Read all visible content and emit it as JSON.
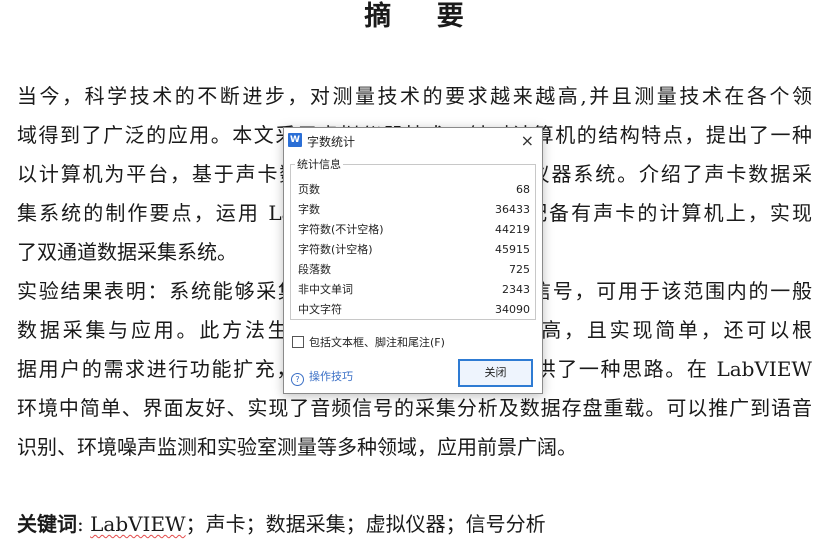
{
  "document": {
    "title": "摘  要",
    "lines": [
      "    当今，科学技术的不断进步，对测量技术的要求越来越高,并且测量技术在各个领",
      "域得到了广泛的应用。本文采用虚拟仪器技术，针对计算机的结构特点，提出了一种",
      "以计算机为平台，基于声卡数据采集的LabVIEW虚拟仪器系统。介绍了声卡数据采",
      "集系统的制作要点，运用 LabVIEW 图形化编程，在配备有声卡的计算机上，实现",
      "了双通道数据采集系统。",
      "    实验结果表明：系统能够采集频率为20Hz～20kHz的信号，可用于该范围内的一般",
      "数据采集与应用。此方法生成的虚拟仪器系统性价比高，且实现简单，还可以根",
      "据用户的需求进行功能扩充，为声卡数据采集的应用提供了一种思路。在 LabVIEW",
      "环境中简单、界面友好、实现了音频信号的采集分析及数据存盘重载。可以推广到语音",
      "识别、环境噪声监测和实验室测量等多种领域，应用前景广阔。"
    ],
    "keywords_label": "关键词",
    "keywords_brand": "LabVIEW",
    "keywords_rest": "；声卡；数据采集；虚拟仪器；信号分析"
  },
  "dialog": {
    "title": "字数统计",
    "app_icon": "W",
    "close_icon": "×",
    "group_label": "统计信息",
    "stats": [
      {
        "label": "页数",
        "value": "68"
      },
      {
        "label": "字数",
        "value": "36433"
      },
      {
        "label": "字符数(不计空格)",
        "value": "44219"
      },
      {
        "label": "字符数(计空格)",
        "value": "45915"
      },
      {
        "label": "段落数",
        "value": "725"
      },
      {
        "label": "非中文单词",
        "value": "2343"
      },
      {
        "label": "中文字符",
        "value": "34090"
      }
    ],
    "checkbox_label": "包括文本框、脚注和尾注(F)",
    "help_link": "操作技巧",
    "close_button": "关闭",
    "accent_color": "#2e7bd3"
  }
}
